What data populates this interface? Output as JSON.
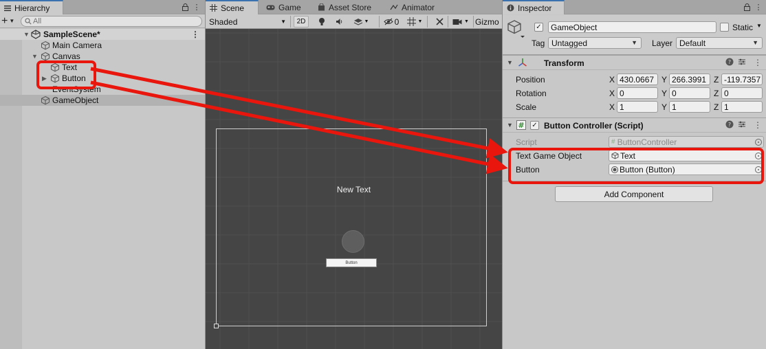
{
  "hierarchy": {
    "tab_label": "Hierarchy",
    "search_placeholder": "All",
    "scene_name": "SampleScene*",
    "items": [
      {
        "label": "Main Camera"
      },
      {
        "label": "Canvas"
      },
      {
        "label": "Text"
      },
      {
        "label": "Button"
      },
      {
        "label": "EventSystem"
      },
      {
        "label": "GameObject"
      }
    ]
  },
  "scene": {
    "tabs": [
      {
        "label": "Scene"
      },
      {
        "label": "Game"
      },
      {
        "label": "Asset Store"
      },
      {
        "label": "Animator"
      }
    ],
    "shading_mode": "Shaded",
    "mode_2d": "2D",
    "hidden_count": "0",
    "gizmos_label": "Gizmo",
    "canvas_text": "New Text",
    "button_text": "Button"
  },
  "inspector": {
    "tab_label": "Inspector",
    "object_name": "GameObject",
    "static_label": "Static",
    "tag_label": "Tag",
    "tag_value": "Untagged",
    "layer_label": "Layer",
    "layer_value": "Default",
    "transform": {
      "title": "Transform",
      "rows": [
        {
          "label": "Position",
          "x": "430.0667",
          "y": "266.3991",
          "z": "-119.7357"
        },
        {
          "label": "Rotation",
          "x": "0",
          "y": "0",
          "z": "0"
        },
        {
          "label": "Scale",
          "x": "1",
          "y": "1",
          "z": "1"
        }
      ],
      "axis_x": "X",
      "axis_y": "Y",
      "axis_z": "Z"
    },
    "script_component": {
      "title": "Button Controller (Script)",
      "script_label": "Script",
      "script_value": "ButtonController",
      "text_go_label": "Text Game Object",
      "text_go_value": "Text",
      "button_label": "Button",
      "button_value": "Button (Button)"
    },
    "add_component_label": "Add Component"
  },
  "colors": {
    "annotation": "#e8160c",
    "tab_accent": "#3a72b0",
    "scene_bg": "#454545"
  }
}
